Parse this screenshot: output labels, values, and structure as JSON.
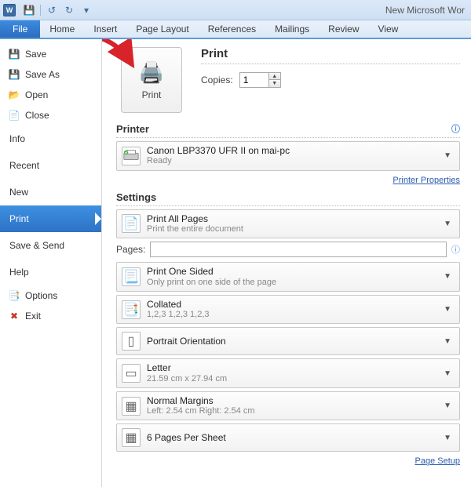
{
  "titlebar": {
    "app_glyph": "W",
    "title": "New Microsoft Wor"
  },
  "ribbon": {
    "tabs": [
      "File",
      "Home",
      "Insert",
      "Page Layout",
      "References",
      "Mailings",
      "Review",
      "View"
    ]
  },
  "sidebar": {
    "save": "Save",
    "saveas": "Save As",
    "open": "Open",
    "close": "Close",
    "info": "Info",
    "recent": "Recent",
    "new": "New",
    "print": "Print",
    "savesend": "Save & Send",
    "help": "Help",
    "options": "Options",
    "exit": "Exit"
  },
  "print": {
    "button_label": "Print",
    "heading": "Print",
    "copies_label": "Copies:",
    "copies_value": "1"
  },
  "printer": {
    "heading": "Printer",
    "name": "Canon LBP3370 UFR II on mai-pc",
    "status": "Ready",
    "props_link": "Printer Properties"
  },
  "settings": {
    "heading": "Settings",
    "printall_title": "Print All Pages",
    "printall_sub": "Print the entire document",
    "pages_label": "Pages:",
    "sided_title": "Print One Sided",
    "sided_sub": "Only print on one side of the page",
    "collated_title": "Collated",
    "collated_sub": "1,2,3    1,2,3    1,2,3",
    "orient_title": "Portrait Orientation",
    "size_title": "Letter",
    "size_sub": "21.59 cm x 27.94 cm",
    "margins_title": "Normal Margins",
    "margins_sub": "Left:  2.54 cm    Right:  2.54 cm",
    "persheet_title": "6 Pages Per Sheet",
    "pagesetup_link": "Page Setup"
  }
}
